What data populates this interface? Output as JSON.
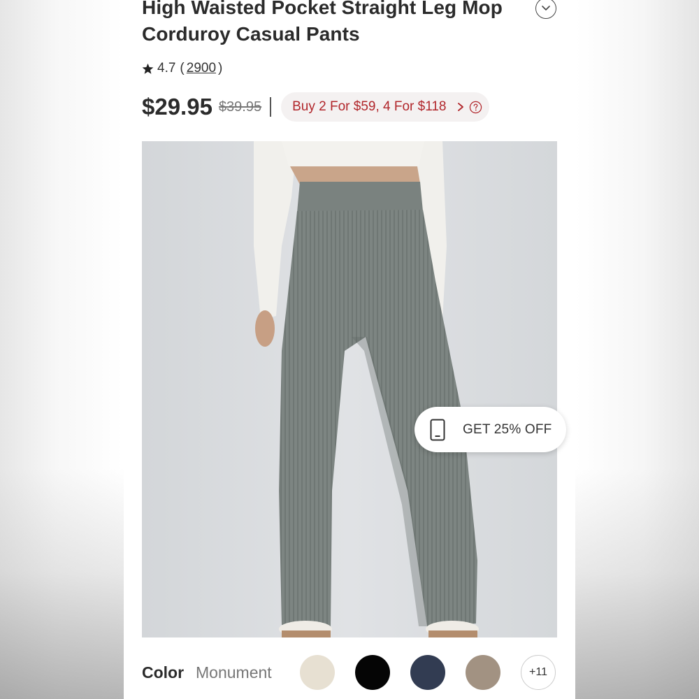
{
  "product": {
    "title": "High Waisted Pocket Straight Leg Mop Corduroy Casual Pants",
    "rating": "4.7",
    "review_open": "(",
    "review_count": "2900",
    "review_close": ")",
    "price": "$29.95",
    "original_price": "$39.95",
    "promo_text": "Buy 2 For $59, 4 For $118"
  },
  "coupon": {
    "label": "GET 25% OFF"
  },
  "colors": {
    "label": "Color",
    "selected_name": "Monument",
    "swatches": [
      "#e7e0d2",
      "#050505",
      "#323c52",
      "#a29282"
    ],
    "more_label": "+11"
  },
  "icons": {
    "expand": "chevron-down-icon",
    "rating": "star-icon",
    "promo_arrow": "chevron-right-icon",
    "promo_help": "question-circle-icon",
    "coupon": "phone-icon"
  },
  "theme": {
    "accent": "#b1262b",
    "text": "#2b2b2b",
    "muted": "#777777"
  }
}
